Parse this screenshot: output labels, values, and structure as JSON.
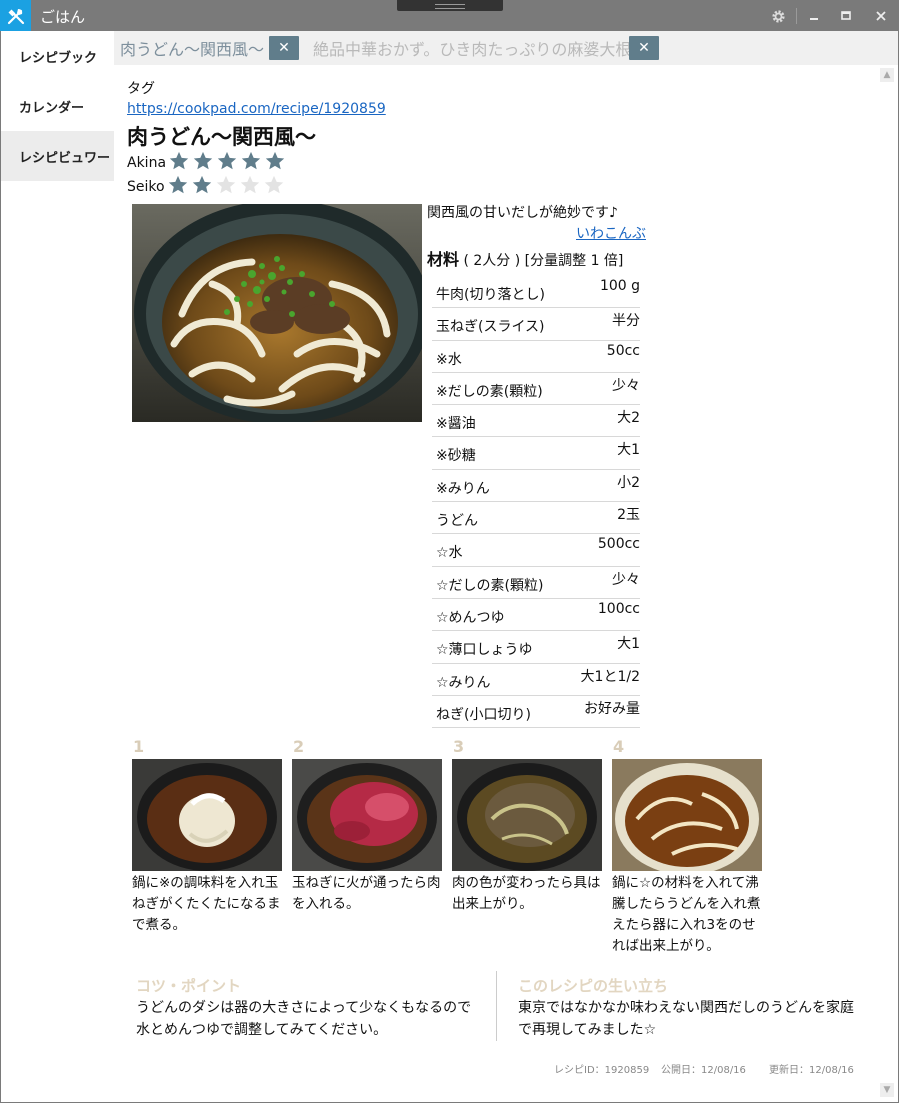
{
  "window": {
    "title": "ごはん"
  },
  "sidebar": {
    "items": [
      {
        "label": "レシピブック"
      },
      {
        "label": "カレンダー"
      },
      {
        "label": "レシピビュワー"
      }
    ]
  },
  "tabs": [
    {
      "label": "肉うどん〜関西風〜",
      "close": "✕"
    },
    {
      "label": "絶品中華おかず。ひき肉たっぷりの麻婆大根",
      "close": "✕"
    }
  ],
  "recipe": {
    "tag_label": "タグ",
    "url": "https://cookpad.com/recipe/1920859",
    "title": "肉うどん〜関西風〜",
    "ratings": [
      {
        "name": "Akina",
        "stars": 5,
        "max": 5
      },
      {
        "name": "Seiko",
        "stars": 2,
        "max": 5
      }
    ],
    "description": "関西風の甘いだしが絶妙です♪",
    "author": "いわこんぶ",
    "ingredients_title": "材料",
    "servings": "( 2人分 )",
    "scale": "[分量調整 1 倍]",
    "ingredients": [
      {
        "name": "牛肉(切り落とし)",
        "qty": "100 g"
      },
      {
        "name": "玉ねぎ(スライス)",
        "qty": "半分"
      },
      {
        "name": "※水",
        "qty": "50cc"
      },
      {
        "name": "※だしの素(顆粒)",
        "qty": "少々"
      },
      {
        "name": "※醤油",
        "qty": "大2"
      },
      {
        "name": "※砂糖",
        "qty": "大1"
      },
      {
        "name": "※みりん",
        "qty": "小2"
      },
      {
        "name": "うどん",
        "qty": "2玉"
      },
      {
        "name": "☆水",
        "qty": "500cc"
      },
      {
        "name": "☆だしの素(顆粒)",
        "qty": "少々"
      },
      {
        "name": "☆めんつゆ",
        "qty": "100cc"
      },
      {
        "name": "☆薄口しょうゆ",
        "qty": "大1"
      },
      {
        "name": "☆みりん",
        "qty": "大1と1/2"
      },
      {
        "name": "ねぎ(小口切り)",
        "qty": "お好み量"
      }
    ],
    "steps": [
      {
        "num": "1",
        "text": "鍋に※の調味料を入れ玉ねぎがくたくたになるまで煮る。"
      },
      {
        "num": "2",
        "text": "玉ねぎに火が通ったら肉を入れる。"
      },
      {
        "num": "3",
        "text": "肉の色が変わったら具は出来上がり。"
      },
      {
        "num": "4",
        "text": "鍋に☆の材料を入れて沸騰したらうどんを入れ煮えたら器に入れ3をのせれば出来上がり。"
      }
    ],
    "tips_title": "コツ・ポイント",
    "tips": "うどんのダシは器の大きさによって少なくもなるので水とめんつゆで調整してみてください。",
    "history_title": "このレシピの生い立ち",
    "history": "東京ではなかなか味わえない関西だしのうどんを家庭で再現してみました☆",
    "meta": {
      "id": "レシピID：1920859",
      "published": "公開日：12/08/16",
      "updated": "更新日：12/08/16"
    }
  },
  "colors": {
    "titlebar": "#7a7a7a",
    "app_icon": "#1ba1e2",
    "tab_close": "#607d8b",
    "star_on": "#607d8b",
    "star_off": "#e3e3e3",
    "link": "#1a66c2",
    "section_title": "#e2d6c1"
  },
  "icons": {
    "app": "utensils-icon",
    "settings": "gear-icon",
    "minimize": "minimize-icon",
    "maximize": "maximize-icon",
    "close": "close-icon"
  }
}
